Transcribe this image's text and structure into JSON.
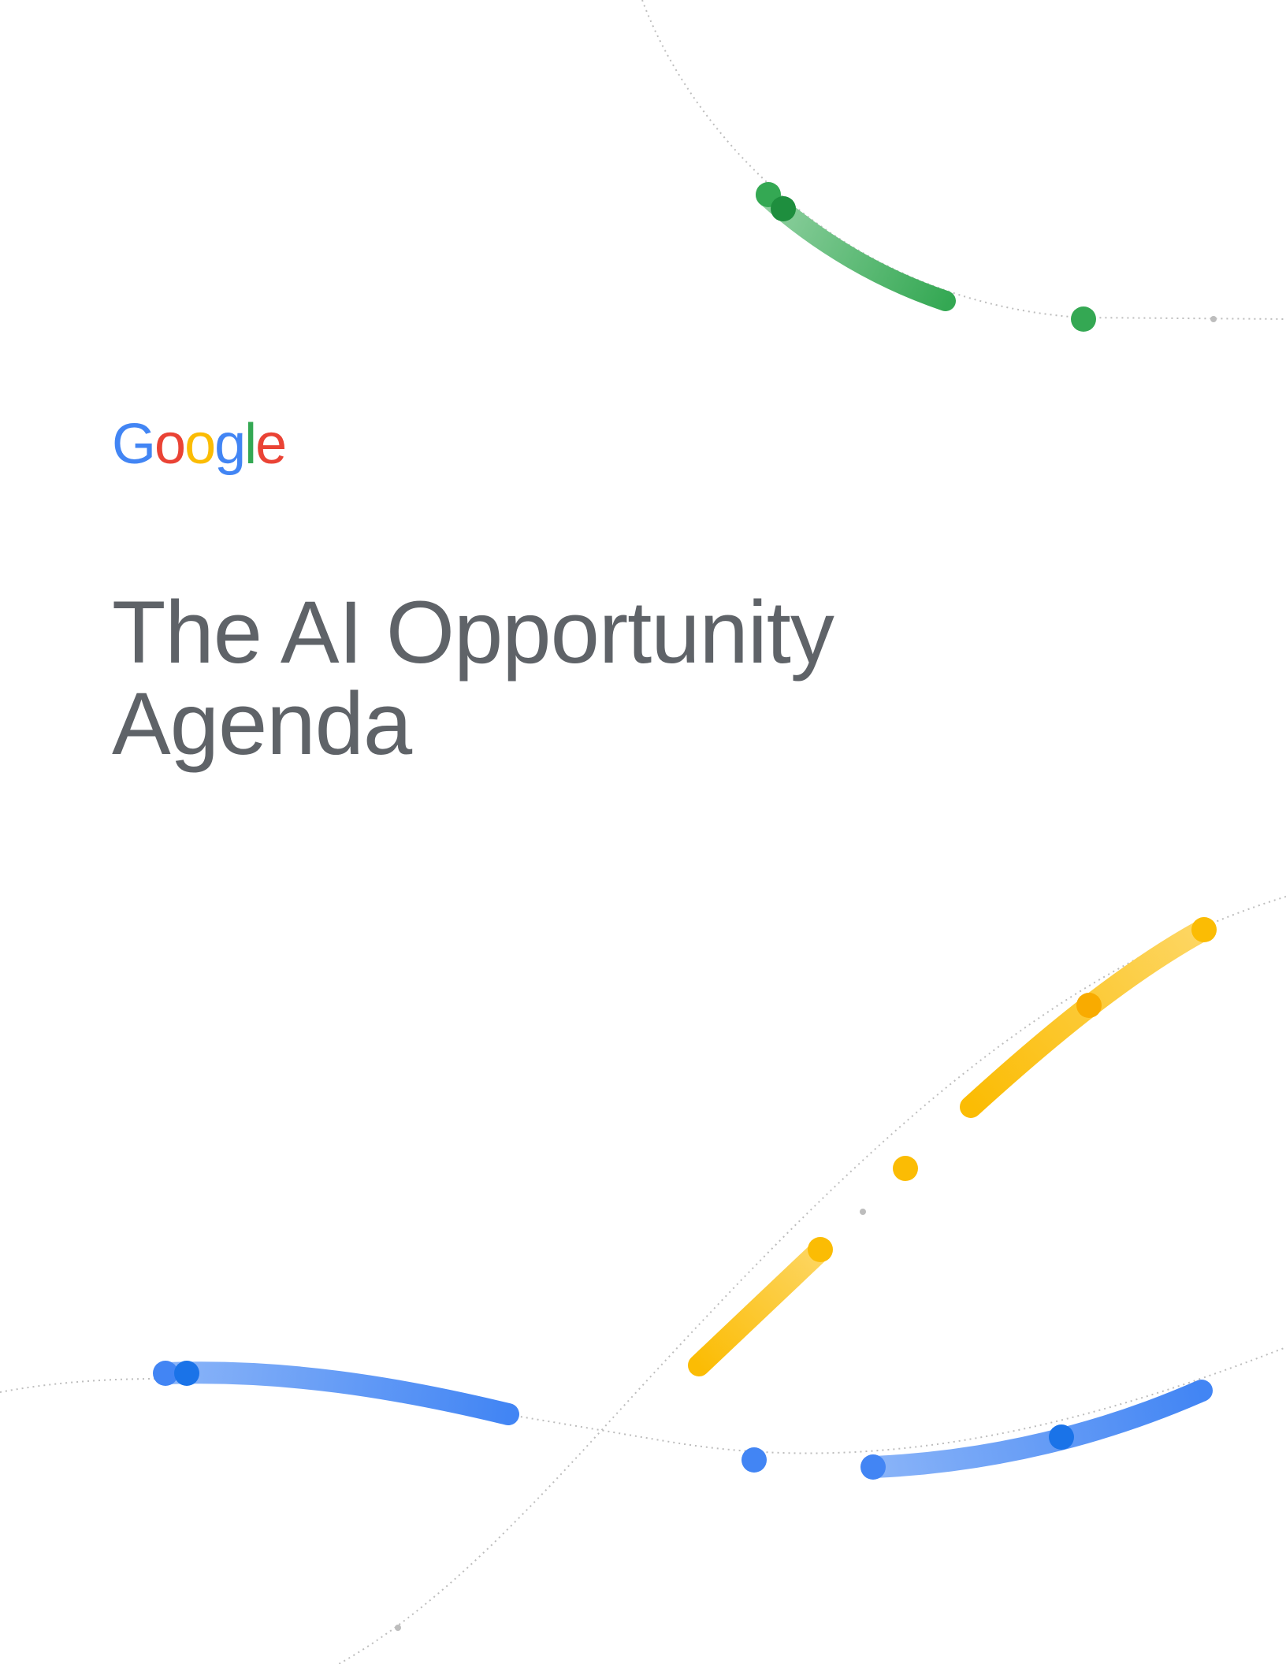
{
  "logo": {
    "letters": [
      "G",
      "o",
      "o",
      "g",
      "l",
      "e"
    ],
    "colors": [
      "#4285F4",
      "#EA4335",
      "#FBBC04",
      "#4285F4",
      "#34A853",
      "#EA4335"
    ]
  },
  "title": {
    "line1": "The AI Opportunity",
    "line2": "Agenda",
    "color": "#5f6368"
  },
  "accents": {
    "green": "#34A853",
    "green_light": "#8FD0A0",
    "yellow": "#FBBC04",
    "yellow_light": "#FDD663",
    "blue": "#4285F4",
    "blue_light": "#8AB4F8",
    "dotted_path": "#bdbdbd"
  }
}
